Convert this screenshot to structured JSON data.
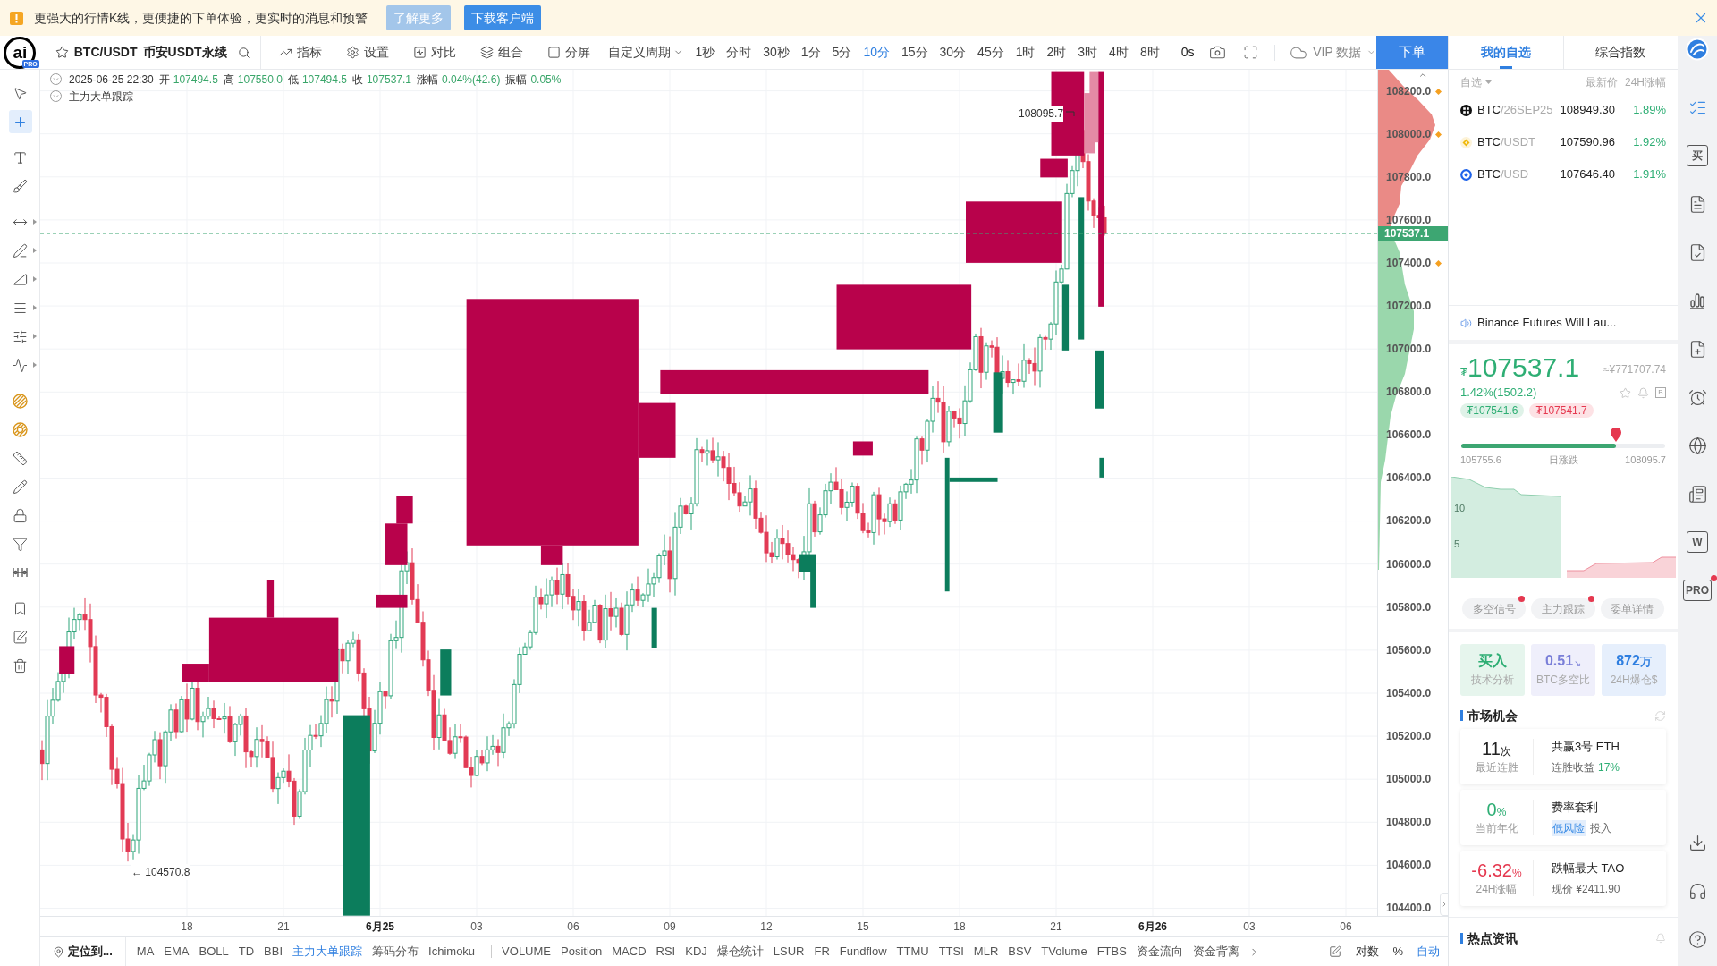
{
  "banner": {
    "message": "更强大的行情K线，更便捷的下单体验，更实时的消息和预警",
    "buttons": [
      {
        "label": "了解更多",
        "kind": "secondary"
      },
      {
        "label": "下载客户端",
        "kind": "primary"
      }
    ]
  },
  "header": {
    "logo_mark": "ai",
    "logo_badge": "PRO",
    "pair": "BTC/USDT",
    "market": "币安USDT永续",
    "tools": [
      {
        "kind": "indicators",
        "label": "指标"
      },
      {
        "kind": "settings",
        "label": "设置"
      },
      {
        "kind": "compare",
        "label": "对比"
      },
      {
        "kind": "combine",
        "label": "组合"
      },
      {
        "kind": "split",
        "label": "分屏"
      }
    ],
    "period_menu": "自定义周期",
    "periods": [
      {
        "label": "1秒",
        "selected": false
      },
      {
        "label": "分时",
        "selected": false
      },
      {
        "label": "30秒",
        "selected": false
      },
      {
        "label": "1分",
        "selected": false
      },
      {
        "label": "5分",
        "selected": false
      },
      {
        "label": "10分",
        "selected": true
      },
      {
        "label": "15分",
        "selected": false
      },
      {
        "label": "30分",
        "selected": false
      },
      {
        "label": "45分",
        "selected": false
      },
      {
        "label": "1时",
        "selected": false
      },
      {
        "label": "2时",
        "selected": false
      },
      {
        "label": "3时",
        "selected": false
      },
      {
        "label": "4时",
        "selected": false
      },
      {
        "label": "8时",
        "selected": false
      }
    ],
    "countdown": "0s",
    "vip_menu": "VIP 数据",
    "order_button": "下单"
  },
  "left_toolbar": [
    [
      {
        "kind": "cursor",
        "selected": false,
        "submenu": false
      },
      {
        "kind": "crosshair",
        "selected": true,
        "submenu": false
      }
    ],
    [
      {
        "kind": "text",
        "selected": false,
        "submenu": false
      },
      {
        "kind": "brush",
        "selected": false,
        "submenu": false
      }
    ],
    [
      {
        "kind": "ray",
        "selected": false,
        "submenu": true
      },
      {
        "kind": "trend",
        "selected": false,
        "submenu": true
      },
      {
        "kind": "angle",
        "selected": false,
        "submenu": true
      },
      {
        "kind": "lines",
        "selected": false,
        "submenu": true
      },
      {
        "kind": "fib",
        "selected": false,
        "submenu": true
      },
      {
        "kind": "wave",
        "selected": false,
        "submenu": true
      }
    ],
    [
      {
        "kind": "pattern",
        "selected": false,
        "submenu": false
      },
      {
        "kind": "pattern2",
        "selected": false,
        "submenu": false
      },
      {
        "kind": "ruler",
        "selected": false,
        "submenu": false
      },
      {
        "kind": "pencil",
        "selected": false,
        "submenu": false
      },
      {
        "kind": "lock",
        "selected": false,
        "submenu": false
      },
      {
        "kind": "magnet",
        "selected": false,
        "submenu": false
      },
      {
        "kind": "measure",
        "selected": false,
        "submenu": false
      }
    ],
    [
      {
        "kind": "bookmark",
        "selected": false,
        "submenu": false
      },
      {
        "kind": "edit",
        "selected": false,
        "submenu": false
      },
      {
        "kind": "trash",
        "selected": false,
        "submenu": false
      }
    ]
  ],
  "chart": {
    "datetime": "2025-06-25 22:30",
    "ohlc": [
      {
        "label": "开",
        "value": "107494.5"
      },
      {
        "label": "高",
        "value": "107550.0"
      },
      {
        "label": "低",
        "value": "107494.5"
      },
      {
        "label": "收",
        "value": "107537.1"
      },
      {
        "label": "涨幅",
        "value": "0.04%(42.6)"
      },
      {
        "label": "振幅",
        "value": "0.05%"
      }
    ],
    "overlay": "主力大单跟踪",
    "high_marker": "108095.7",
    "low_marker": "← 104570.8",
    "last_price": "107537.1",
    "price_labels": [
      {
        "text": "108200.0",
        "alert": true
      },
      {
        "text": "108000.0",
        "alert": true
      },
      {
        "text": "107800.0",
        "alert": false
      },
      {
        "text": "107600.0",
        "alert": false
      },
      {
        "text": "107400.0",
        "alert": true
      },
      {
        "text": "107200.0",
        "alert": false
      },
      {
        "text": "107000.0",
        "alert": false
      },
      {
        "text": "106800.0",
        "alert": false
      },
      {
        "text": "106600.0",
        "alert": false
      },
      {
        "text": "106400.0",
        "alert": false
      },
      {
        "text": "106200.0",
        "alert": false
      },
      {
        "text": "106000.0",
        "alert": false
      },
      {
        "text": "105800.0",
        "alert": false
      },
      {
        "text": "105600.0",
        "alert": false
      },
      {
        "text": "105400.0",
        "alert": false
      },
      {
        "text": "105200.0",
        "alert": false
      },
      {
        "text": "105000.0",
        "alert": false
      },
      {
        "text": "104800.0",
        "alert": false
      },
      {
        "text": "104600.0",
        "alert": false
      },
      {
        "text": "104400.0",
        "alert": false
      }
    ],
    "time_labels": [
      {
        "text": "18",
        "major": false
      },
      {
        "text": "21",
        "major": false
      },
      {
        "text": "6月25",
        "major": true
      },
      {
        "text": "03",
        "major": false
      },
      {
        "text": "06",
        "major": false
      },
      {
        "text": "09",
        "major": false
      },
      {
        "text": "12",
        "major": false
      },
      {
        "text": "15",
        "major": false
      },
      {
        "text": "18",
        "major": false
      },
      {
        "text": "21",
        "major": false
      },
      {
        "text": "6月26",
        "major": true
      },
      {
        "text": "03",
        "major": false
      },
      {
        "text": "06",
        "major": false
      }
    ]
  },
  "indicator_bar": {
    "locate": "定位到...",
    "main": [
      {
        "label": "MA",
        "selected": false
      },
      {
        "label": "EMA",
        "selected": false
      },
      {
        "label": "BOLL",
        "selected": false
      },
      {
        "label": "TD",
        "selected": false
      },
      {
        "label": "BBI",
        "selected": false
      },
      {
        "label": "主力大单跟踪",
        "selected": true
      },
      {
        "label": "筹码分布",
        "selected": false
      },
      {
        "label": "Ichimoku",
        "selected": false
      }
    ],
    "sub": [
      {
        "label": "VOLUME",
        "selected": false
      },
      {
        "label": "Position",
        "selected": false
      },
      {
        "label": "MACD",
        "selected": false
      },
      {
        "label": "RSI",
        "selected": false
      },
      {
        "label": "KDJ",
        "selected": false
      },
      {
        "label": "爆仓统计",
        "selected": false
      },
      {
        "label": "LSUR",
        "selected": false
      },
      {
        "label": "FR",
        "selected": false
      },
      {
        "label": "Fundflow",
        "selected": false
      },
      {
        "label": "TTMU",
        "selected": false
      },
      {
        "label": "TTSI",
        "selected": false
      },
      {
        "label": "MLR",
        "selected": false
      },
      {
        "label": "BSV",
        "selected": false
      },
      {
        "label": "TVolume",
        "selected": false
      },
      {
        "label": "FTBS",
        "selected": false
      },
      {
        "label": "资金流向",
        "selected": false
      },
      {
        "label": "资金背离",
        "selected": false
      }
    ],
    "scale": [
      {
        "label": "对数",
        "selected": false
      },
      {
        "label": "%",
        "selected": false
      },
      {
        "label": "自动",
        "selected": true
      }
    ]
  },
  "panel_tabs": [
    {
      "label": "我的自选",
      "selected": true
    },
    {
      "label": "综合指数",
      "selected": false
    }
  ],
  "watchlist": {
    "filter": "自选",
    "columns": [
      "最新价",
      "24H涨幅"
    ],
    "rows": [
      {
        "kind": "cross",
        "base": "BTC",
        "quote": "/26SEP25",
        "price": "108949.30",
        "change": "1.89%"
      },
      {
        "kind": "diamond",
        "base": "BTC",
        "quote": "/USDT",
        "price": "107590.96",
        "change": "1.92%"
      },
      {
        "kind": "ring",
        "base": "BTC",
        "quote": "/USD",
        "price": "107646.40",
        "change": "1.91%"
      }
    ]
  },
  "announcement": "Binance Futures Will Lau...",
  "ticker": {
    "currency": "₮",
    "price": "107537.1",
    "converted": "≈¥771707.74",
    "change": "1.42%(1502.2)",
    "box_label": "B",
    "bid": "₮107541.6",
    "ask": "₮107541.7",
    "range_low": "105755.6",
    "range_label": "日涨跌",
    "range_high": "108095.7",
    "level": 0.76,
    "depth_ticks": [
      "10",
      "5"
    ]
  },
  "signal_tabs": [
    {
      "label": "多空信号",
      "dot": true
    },
    {
      "label": "主力跟踪",
      "dot": true
    },
    {
      "label": "委单详情",
      "dot": false
    }
  ],
  "stats": [
    {
      "kind": "signal",
      "value": "买入",
      "label": "技术分析"
    },
    {
      "kind": "ratio",
      "value": "0.51",
      "arrow": "↘",
      "label": "BTC多空比"
    },
    {
      "kind": "liquidation",
      "value": "872",
      "unit": "万",
      "label": "24H爆仓$"
    }
  ],
  "opportunities": {
    "title": "市场机会",
    "items": [
      {
        "value": "11",
        "unit": "次",
        "color": "#222222",
        "caption": "最近连胜",
        "title": "共赢3号 ETH",
        "detail": "连胜收益",
        "highlight": "17%"
      },
      {
        "value": "0",
        "unit": "%",
        "color": "#2eae74",
        "caption": "当前年化",
        "title": "费率套利",
        "tag": "低风险",
        "detail": "投入"
      },
      {
        "value": "-6.32",
        "unit": "%",
        "color": "#e5384f",
        "caption": "24H涨幅",
        "title": "跌幅最大 TAO",
        "detail": "现价 ¥2411.90"
      }
    ]
  },
  "hot_news": {
    "title": "热点资讯"
  },
  "right_rail": {
    "top": [
      {
        "kind": "logo",
        "selected": false
      },
      {
        "kind": "watchlist",
        "selected": true
      },
      {
        "kind": "text",
        "label": "买",
        "selected": false
      },
      {
        "kind": "chart",
        "selected": false
      },
      {
        "kind": "check",
        "selected": false
      },
      {
        "kind": "bars",
        "selected": false
      },
      {
        "kind": "add",
        "selected": false
      },
      {
        "kind": "alarm",
        "selected": false
      },
      {
        "kind": "planet",
        "selected": false
      },
      {
        "kind": "list",
        "selected": false
      },
      {
        "kind": "text",
        "label": "W",
        "selected": false
      },
      {
        "kind": "text",
        "label": "PRO",
        "selected": false,
        "dot": true
      }
    ],
    "bottom": [
      {
        "kind": "download",
        "selected": false
      },
      {
        "kind": "headset",
        "selected": false
      },
      {
        "kind": "help",
        "selected": false
      }
    ]
  }
}
